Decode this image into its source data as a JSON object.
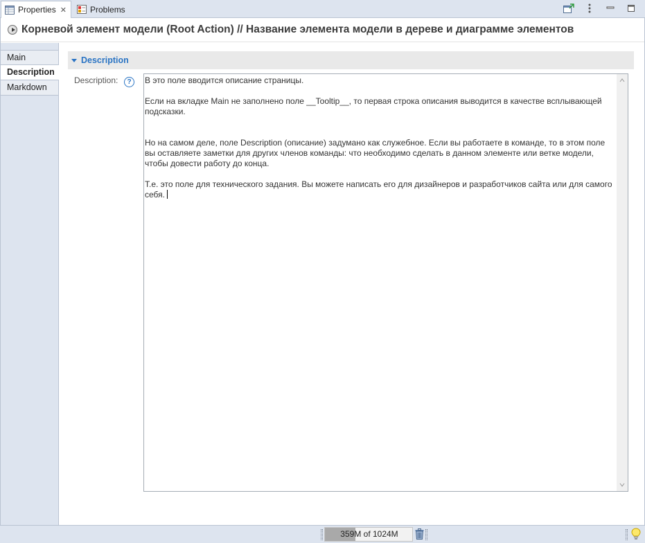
{
  "tabs": {
    "properties_label": "Properties",
    "problems_label": "Problems",
    "close_glyph": "✕"
  },
  "header": {
    "title": "Корневой элемент модели (Root Action) // Название элемента модели в дереве и диаграмме элементов",
    "icon": "root-action-icon"
  },
  "side_tabs": [
    {
      "label": "Main",
      "selected": false
    },
    {
      "label": "Description",
      "selected": true
    },
    {
      "label": "Markdown",
      "selected": false
    }
  ],
  "section": {
    "title": "Description",
    "expanded": true
  },
  "field": {
    "label": "Description:",
    "help_glyph": "?",
    "paragraphs": [
      "В это поле вводится описание страницы.",
      "",
      "Если на вкладке Main не заполнено поле __Tooltip__, то первая строка описания выводится в качестве всплывающей подсказки.",
      "",
      "",
      "Но на самом деле, поле Description (описание) задумано как служебное. Если вы работаете в команде, то в этом поле вы оставляете заметки для других членов команды: что необходимо сделать в данном элементе или ветке  модели, чтобы довести работу до конца.",
      "",
      "Т.е. это поле для технического задания. Вы можете написать его для дизайнеров и разработчиков сайта или для самого себя."
    ]
  },
  "status": {
    "heap_text": "359M of 1024M",
    "heap_used_mb": 359,
    "heap_total_mb": 1024
  },
  "colors": {
    "accent": "#2a74c4",
    "chrome": "#dde4ef"
  }
}
